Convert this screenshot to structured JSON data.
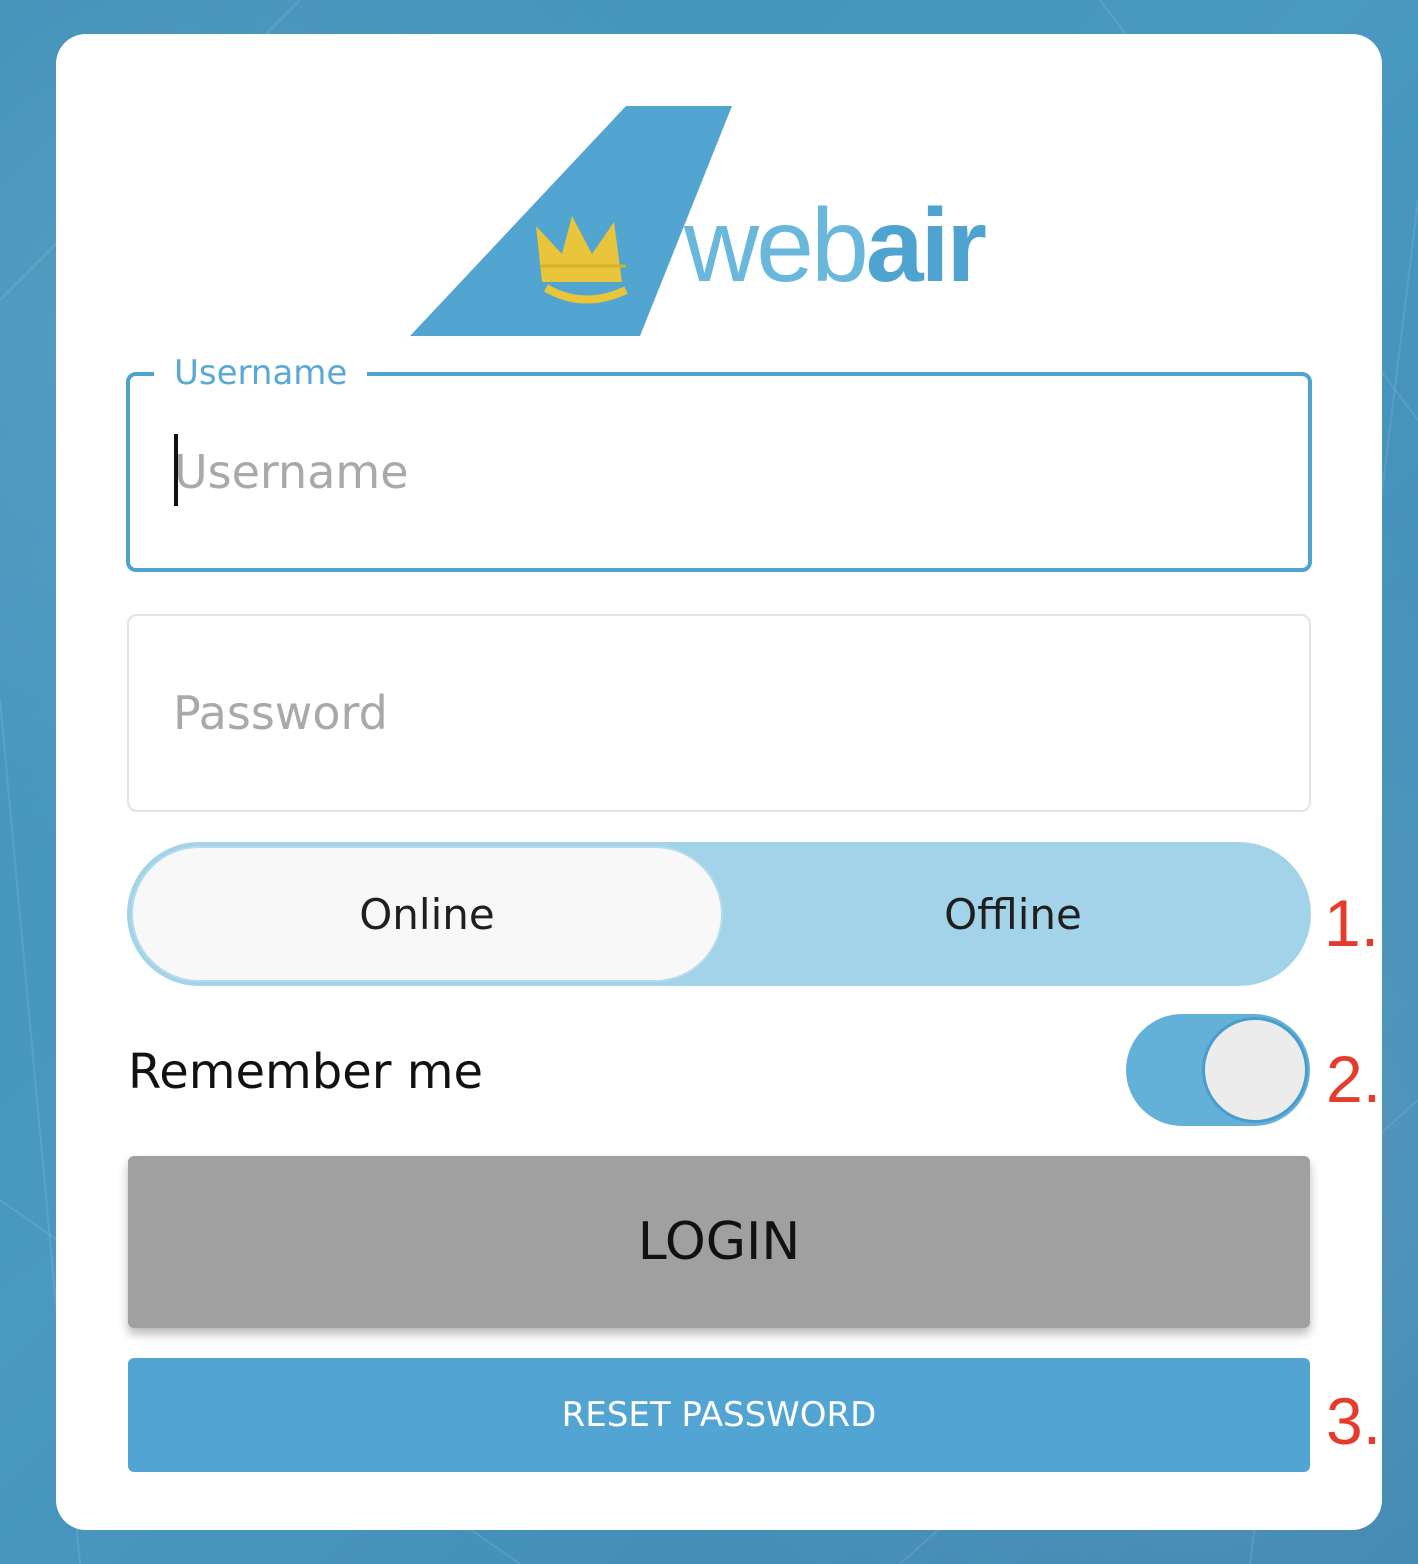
{
  "brand": {
    "logo_part1": "web",
    "logo_part2": "air",
    "tail_color": "#52a4d1",
    "crown_color": "#e8c53a"
  },
  "form": {
    "username": {
      "label": "Username",
      "placeholder": "Username",
      "value": ""
    },
    "password": {
      "placeholder": "Password",
      "value": ""
    },
    "mode": {
      "options": [
        "Online",
        "Offline"
      ],
      "selected": "Online"
    },
    "remember_me": {
      "label": "Remember me",
      "checked": true
    },
    "login_label": "LOGIN",
    "reset_label": "RESET PASSWORD"
  },
  "annotations": [
    "1.",
    "2.",
    "3."
  ],
  "colors": {
    "background": "#4a99c3",
    "accent": "#4fa3d1",
    "segment_bg": "#a3d3e8",
    "login_bg": "#a0a0a0",
    "reset_bg": "#52a4d2",
    "annotation": "#e53b2b"
  }
}
